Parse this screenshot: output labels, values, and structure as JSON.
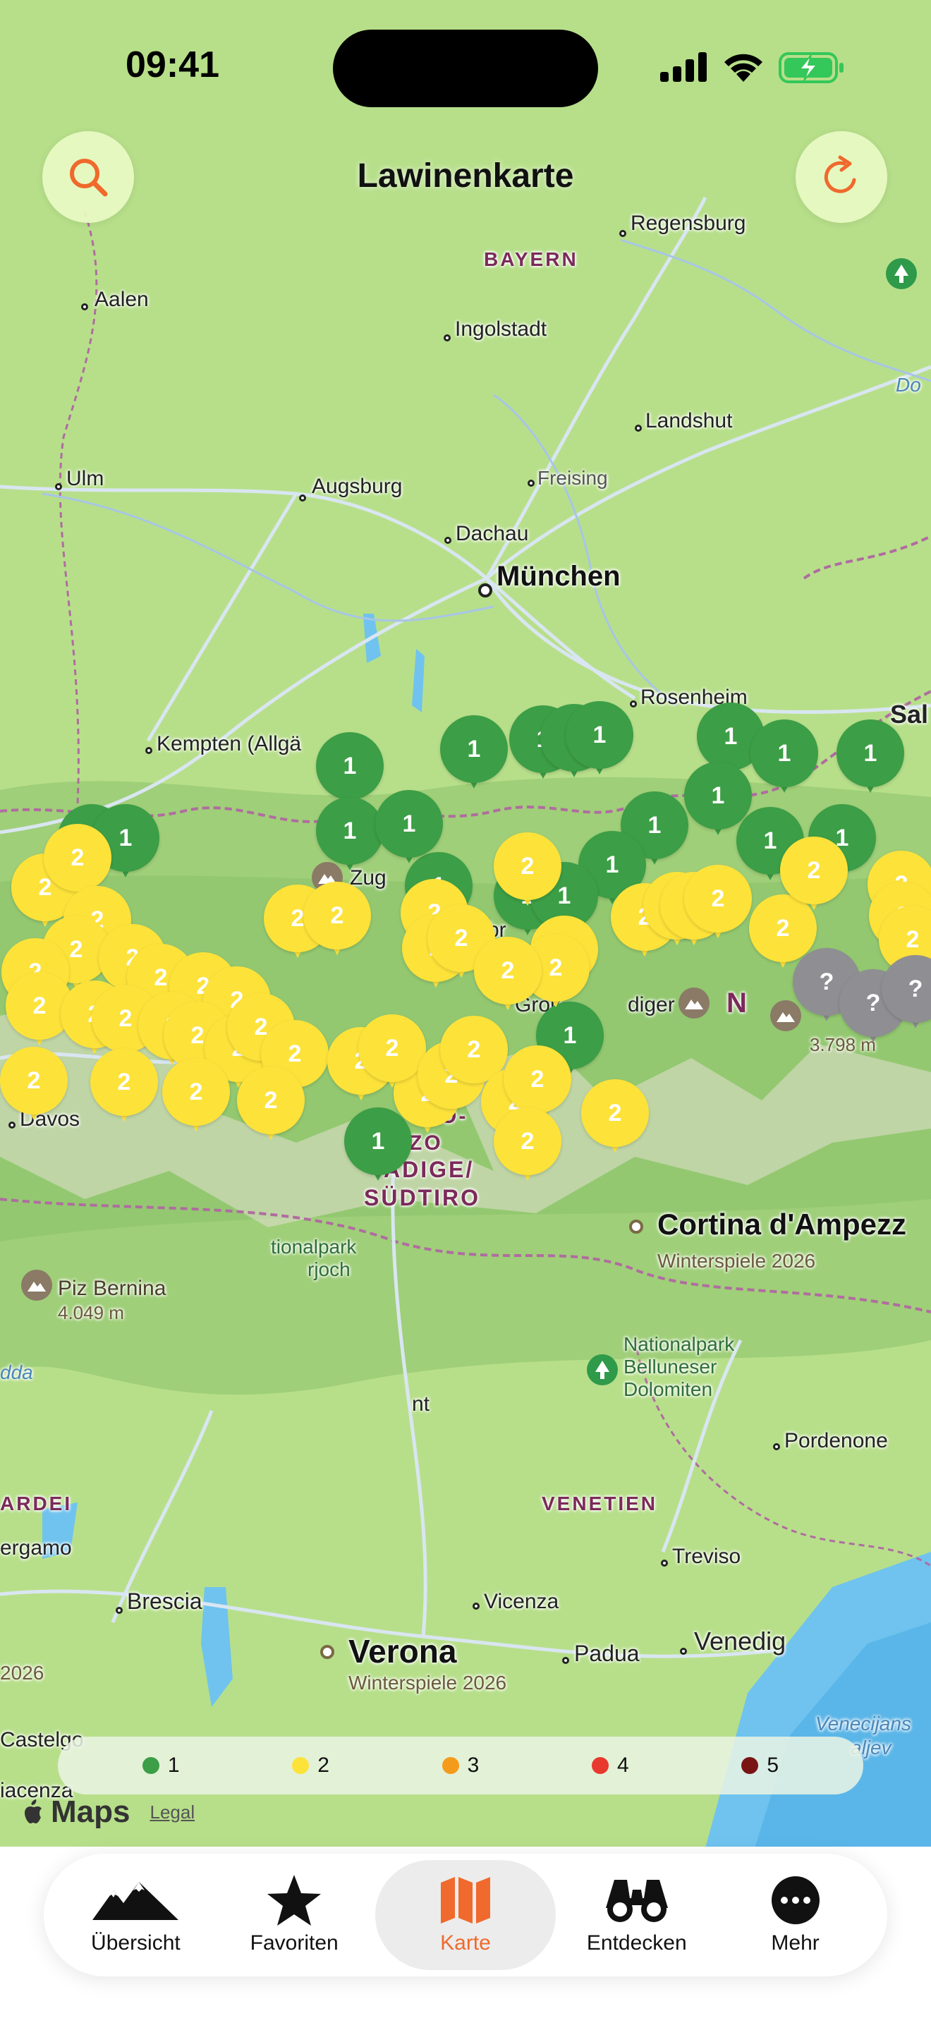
{
  "status_bar": {
    "time": "09:41"
  },
  "header": {
    "title": "Lawinenkarte"
  },
  "map": {
    "cities": [
      {
        "name": "Regensburg"
      },
      {
        "name": "Aalen"
      },
      {
        "name": "Ingolstadt"
      },
      {
        "name": "Landshut"
      },
      {
        "name": "Ulm"
      },
      {
        "name": "Augsburg"
      },
      {
        "name": "Freising"
      },
      {
        "name": "Dachau"
      },
      {
        "name": "München"
      },
      {
        "name": "Rosenheim"
      },
      {
        "name": "Kempten (Allgä"
      },
      {
        "name": "Sal"
      },
      {
        "name": "Davos"
      },
      {
        "name": "Cortina d'Ampezz"
      },
      {
        "name": "Pordenone"
      },
      {
        "name": "Treviso"
      },
      {
        "name": "Brescia"
      },
      {
        "name": "Vicenza"
      },
      {
        "name": "Verona"
      },
      {
        "name": "Padua"
      },
      {
        "name": "Venedig"
      },
      {
        "name": "ergamo"
      },
      {
        "name": "Castelgo"
      },
      {
        "name": "iacenza"
      }
    ],
    "regions": [
      "BAYERN",
      "ARDEI",
      "VENETIEN",
      "ADIGE/",
      "SÜDTIRO"
    ],
    "subtitles": [
      "Winterspiele 2026",
      "Winterspiele 2026",
      "2026"
    ],
    "peaks": [
      {
        "name": "Piz Bernina",
        "elevation": "4.049 m"
      },
      {
        "name": "",
        "elevation": "3.798 m"
      }
    ],
    "parks": [
      {
        "name": "Nationalpark Belluneser Dolomiten",
        "lines": [
          "Nationalpark",
          "Belluneser",
          "Dolomiten"
        ]
      },
      {
        "name": "tionalpark rjoch",
        "lines": [
          "tionalpark",
          "rjoch"
        ]
      }
    ],
    "water_labels": [
      "dda",
      "Venecijans",
      "aljev",
      "Do"
    ],
    "misc_labels": [
      "Zug",
      "sbr",
      "Groß",
      "diger",
      "nt",
      "N",
      "O-",
      "ZO"
    ]
  },
  "danger_markers": [
    {
      "level": "1"
    },
    {
      "level": "1"
    },
    {
      "level": "1"
    },
    {
      "level": "1"
    },
    {
      "level": "1"
    },
    {
      "level": "1"
    },
    {
      "level": "1"
    },
    {
      "level": "1"
    },
    {
      "level": "1"
    },
    {
      "level": "1"
    },
    {
      "level": "1"
    },
    {
      "level": "1"
    },
    {
      "level": "1"
    },
    {
      "level": "1"
    },
    {
      "level": "1"
    },
    {
      "level": "1"
    },
    {
      "level": "1"
    },
    {
      "level": "1"
    },
    {
      "level": "1"
    },
    {
      "level": "1"
    },
    {
      "level": "1"
    },
    {
      "level": "1"
    },
    {
      "level": "2"
    },
    {
      "level": "2"
    },
    {
      "level": "2"
    },
    {
      "level": "2"
    },
    {
      "level": "2"
    },
    {
      "level": "2"
    },
    {
      "level": "2"
    },
    {
      "level": "2"
    },
    {
      "level": "2"
    },
    {
      "level": "2"
    },
    {
      "level": "2"
    },
    {
      "level": "2"
    },
    {
      "level": "2"
    },
    {
      "level": "2"
    },
    {
      "level": "2"
    },
    {
      "level": "2"
    },
    {
      "level": "2"
    },
    {
      "level": "2"
    },
    {
      "level": "2"
    },
    {
      "level": "2"
    },
    {
      "level": "2"
    },
    {
      "level": "2"
    },
    {
      "level": "2"
    },
    {
      "level": "2"
    },
    {
      "level": "2"
    },
    {
      "level": "2"
    },
    {
      "level": "2"
    },
    {
      "level": "2"
    },
    {
      "level": "2"
    },
    {
      "level": "2"
    },
    {
      "level": "2"
    },
    {
      "level": "2"
    },
    {
      "level": "2"
    },
    {
      "level": "2"
    },
    {
      "level": "2"
    },
    {
      "level": "2"
    },
    {
      "level": "2"
    },
    {
      "level": "2"
    },
    {
      "level": "2"
    },
    {
      "level": "2"
    },
    {
      "level": "2"
    },
    {
      "level": "2"
    },
    {
      "level": "2"
    },
    {
      "level": "2"
    },
    {
      "level": "2"
    },
    {
      "level": "2"
    },
    {
      "level": "2"
    },
    {
      "level": "2"
    },
    {
      "level": "?"
    },
    {
      "level": "?"
    },
    {
      "level": "?"
    }
  ],
  "legend": {
    "items": [
      {
        "label": "1",
        "color": "#3c9e46"
      },
      {
        "label": "2",
        "color": "#fde23a"
      },
      {
        "label": "3",
        "color": "#f59b1c"
      },
      {
        "label": "4",
        "color": "#e8392e"
      },
      {
        "label": "5",
        "color": "#7a1414"
      }
    ]
  },
  "attribution": {
    "brand": "Maps",
    "legal": "Legal"
  },
  "tabs": [
    {
      "label": "Übersicht",
      "icon": "mountains-icon"
    },
    {
      "label": "Favoriten",
      "icon": "star-icon"
    },
    {
      "label": "Karte",
      "icon": "map-icon",
      "active": true
    },
    {
      "label": "Entdecken",
      "icon": "binoculars-icon"
    },
    {
      "label": "Mehr",
      "icon": "ellipsis-icon"
    }
  ],
  "colors": {
    "accent": "#ef6a2c",
    "level1": "#3c9e46",
    "level2": "#fde23a",
    "unknown": "#8e8e93",
    "button_bg": "#e8fac4"
  }
}
